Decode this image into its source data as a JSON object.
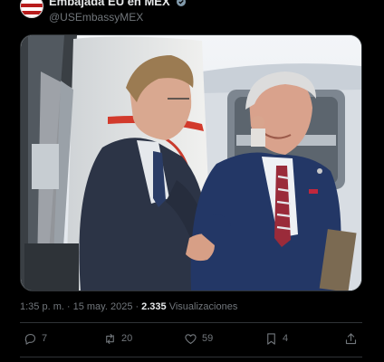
{
  "author": {
    "display_name": "Embajada EU en MEX",
    "handle": "@USEmbassyMEX"
  },
  "media": {
    "alt": "Dos hombres de traje se saludan frente a la puerta de un avión"
  },
  "meta": {
    "time": "1:35 p. m.",
    "separator": "·",
    "date": "15 may. 2025",
    "views_count": "2.335",
    "views_label": "Visualizaciones"
  },
  "actions": {
    "replies": "7",
    "reposts": "20",
    "likes": "59",
    "bookmarks": "4"
  },
  "icons": {
    "reply": "reply-icon",
    "repost": "repost-icon",
    "like": "heart-icon",
    "bookmark": "bookmark-icon",
    "share": "share-icon",
    "verified": "verified-badge-icon"
  },
  "colors": {
    "background": "#000000",
    "text": "#e7e9ea",
    "muted": "#71767b",
    "divider": "#2f3336",
    "verified": "#829aab"
  }
}
